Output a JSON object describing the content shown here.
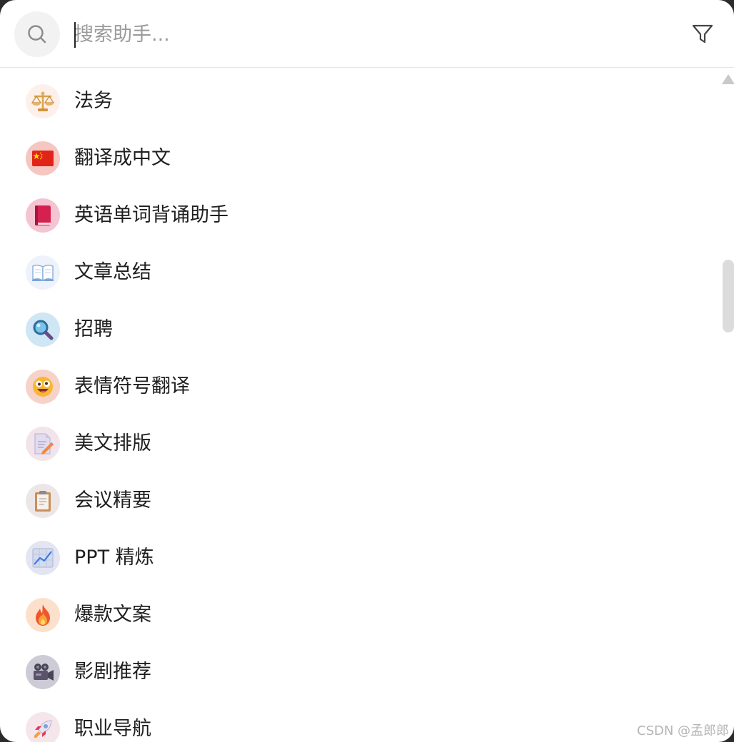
{
  "search": {
    "placeholder": "搜索助手..."
  },
  "assistants": [
    {
      "label": "法务",
      "icon": "balance-scale-icon",
      "bg": "#fdf0ea"
    },
    {
      "label": "翻译成中文",
      "icon": "china-flag-icon",
      "bg": "#f6c6c0"
    },
    {
      "label": "英语单词背诵助手",
      "icon": "red-book-icon",
      "bg": "#f4c4d2"
    },
    {
      "label": "文章总结",
      "icon": "open-book-icon",
      "bg": "#eef2fb"
    },
    {
      "label": "招聘",
      "icon": "magnifying-glass-icon",
      "bg": "#cfe6f4"
    },
    {
      "label": "表情符号翻译",
      "icon": "zany-face-icon",
      "bg": "#f6d2c8"
    },
    {
      "label": "美文排版",
      "icon": "memo-icon",
      "bg": "#f1e4ea"
    },
    {
      "label": "会议精要",
      "icon": "clipboard-icon",
      "bg": "#ede6e6"
    },
    {
      "label": "PPT 精炼",
      "icon": "chart-increasing-icon",
      "bg": "#e3e5f2"
    },
    {
      "label": "爆款文案",
      "icon": "fire-icon",
      "bg": "#fde0cc"
    },
    {
      "label": "影剧推荐",
      "icon": "movie-camera-icon",
      "bg": "#cdcbd6"
    },
    {
      "label": "职业导航",
      "icon": "rocket-icon",
      "bg": "#f5e6ec"
    }
  ],
  "watermark": "CSDN @孟郎郎"
}
